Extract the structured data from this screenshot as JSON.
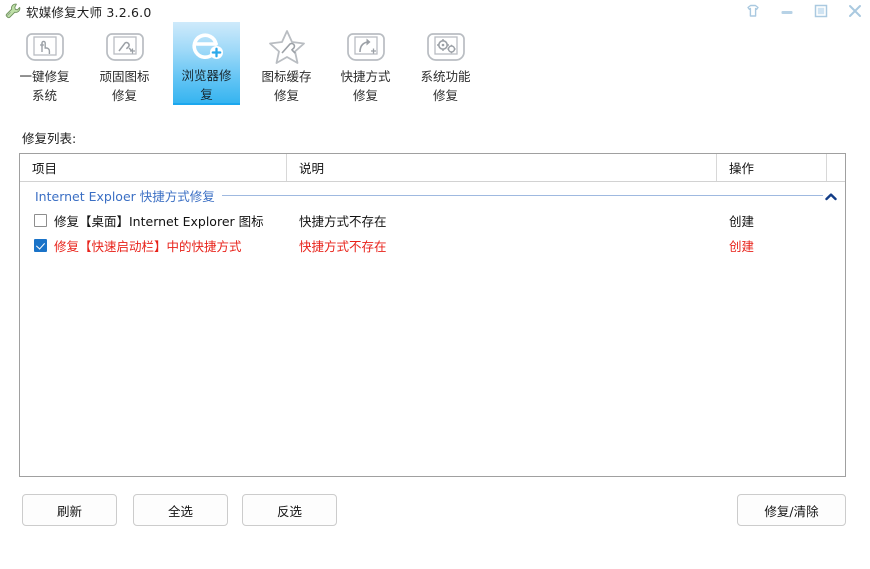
{
  "window": {
    "title": "软媒修复大师 3.2.6.0",
    "icon": "wrench-icon",
    "controls": {
      "skin": "skin-icon",
      "minimize": "minimize-icon",
      "maximize": "maximize-icon",
      "close": "close-icon"
    }
  },
  "tabs": [
    {
      "id": "one-key-repair-system",
      "line1": "一键修复",
      "line2": "系统",
      "icon": "hand-click-icon",
      "active": false
    },
    {
      "id": "stubborn-icon-repair",
      "line1": "顽固图标",
      "line2": "修复",
      "icon": "image-wrench-icon",
      "active": false
    },
    {
      "id": "browser-repair",
      "line1": "浏览器修",
      "line2": "复",
      "icon": "ie-plus-icon",
      "active": true
    },
    {
      "id": "icon-cache-repair",
      "line1": "图标缓存",
      "line2": "修复",
      "icon": "star-wrench-icon",
      "active": false
    },
    {
      "id": "shortcut-repair",
      "line1": "快捷方式",
      "line2": "修复",
      "icon": "shortcut-plus-icon",
      "active": false
    },
    {
      "id": "system-function-repair",
      "line1": "系统功能",
      "line2": "修复",
      "icon": "gears-plus-icon",
      "active": false
    }
  ],
  "section": {
    "label": "修复列表:"
  },
  "list": {
    "columns": {
      "item": "项目",
      "description": "说明",
      "action": "操作"
    },
    "group": {
      "title": "Internet Exploer 快捷方式修复",
      "collapse_icon": "chevron-up-icon"
    },
    "rows": [
      {
        "checked": false,
        "item": "修复【桌面】Internet Explorer 图标",
        "description": "快捷方式不存在",
        "action": "创建",
        "alert": false
      },
      {
        "checked": true,
        "item": "修复【快速启动栏】中的快捷方式",
        "description": "快捷方式不存在",
        "action": "创建",
        "alert": true
      }
    ]
  },
  "buttons": {
    "refresh": "刷新",
    "select_all": "全选",
    "invert": "反选",
    "fix_clear": "修复/清除"
  },
  "colors": {
    "accent": "#1ca7ee",
    "group_title": "#3b6fc4",
    "alert": "#e8221a",
    "checkbox_checked": "#1a73c8"
  }
}
